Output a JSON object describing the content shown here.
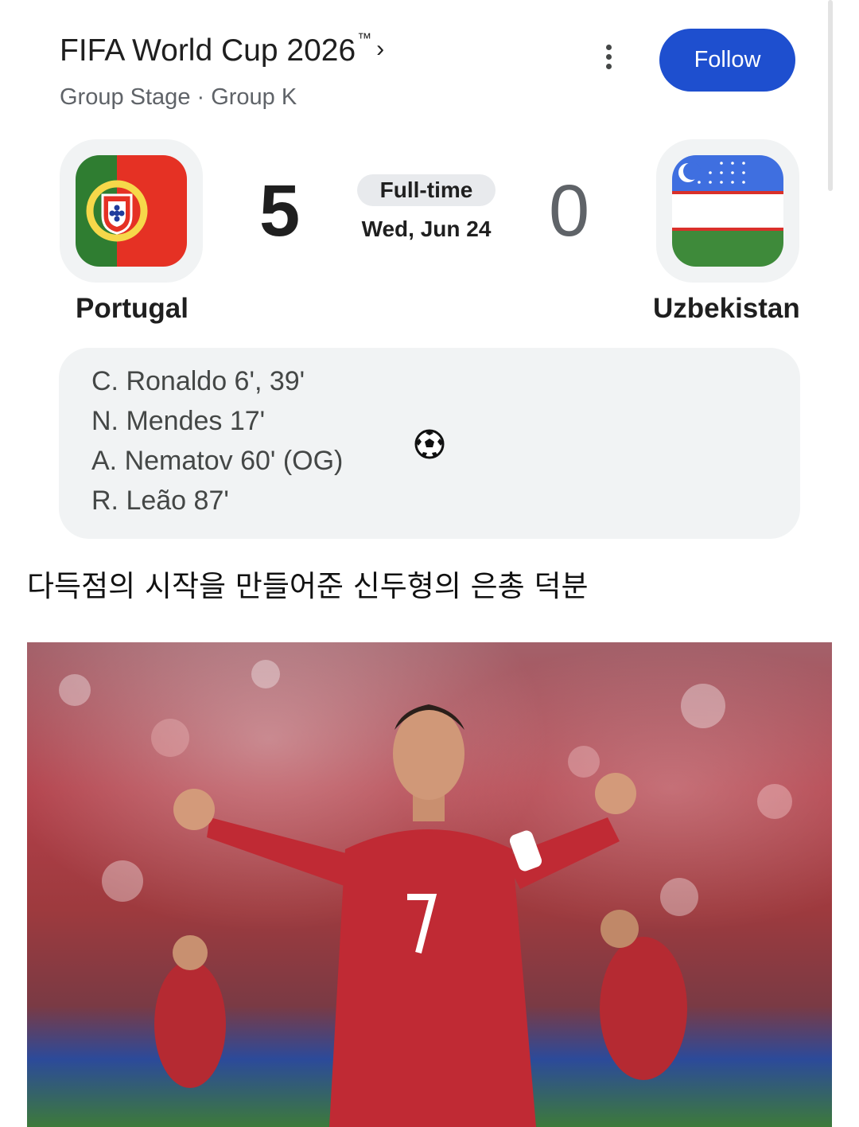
{
  "header": {
    "title": "FIFA World Cup 2026",
    "trademark": "™",
    "subtitle": "Group Stage · Group K",
    "follow_label": "Follow"
  },
  "match": {
    "status": "Full-time",
    "date": "Wed, Jun 24",
    "home": {
      "name": "Portugal",
      "score": "5",
      "flag": "portugal-flag"
    },
    "away": {
      "name": "Uzbekistan",
      "score": "0",
      "flag": "uzbekistan-flag"
    }
  },
  "scorers": [
    "C. Ronaldo 6', 39'",
    "N. Mendes 17'",
    "A. Nematov 60' (OG)",
    "R. Leão 87'"
  ],
  "caption": "다득점의 시작을 만들어준 신두형의 은총 덕분",
  "photo": {
    "icon": "player-celebration-photo"
  },
  "colors": {
    "accent": "#1e4fcf",
    "card_bg": "#f1f3f4"
  }
}
